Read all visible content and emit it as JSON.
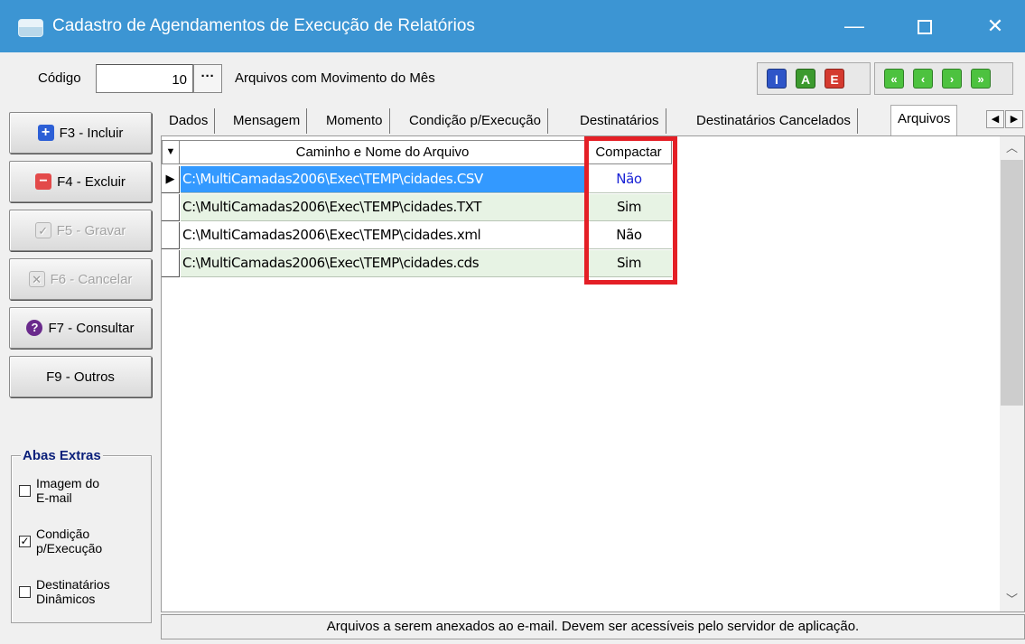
{
  "window": {
    "title": "Cadastro de Agendamentos de Execução de Relatórios",
    "minimize": "—",
    "close": "✕"
  },
  "toprow": {
    "codigo_label": "Código",
    "codigo_value": "10",
    "ellipsis": "···",
    "description": "Arquivos com Movimento do Mês",
    "mode_buttons": [
      "I",
      "A",
      "E"
    ],
    "nav_buttons": [
      "«",
      "‹",
      "›",
      "»"
    ]
  },
  "commands": [
    {
      "label": "F3 - Incluir",
      "icon": "plus-icon",
      "glyph": "+",
      "enabled": true
    },
    {
      "label": "F4 - Excluir",
      "icon": "minus-icon",
      "glyph": "−",
      "enabled": true
    },
    {
      "label": "F5 - Gravar",
      "icon": "check-icon",
      "glyph": "✓",
      "enabled": false
    },
    {
      "label": "F6 - Cancelar",
      "icon": "x-icon",
      "glyph": "✕",
      "enabled": false
    },
    {
      "label": "F7 - Consultar",
      "icon": "help-icon",
      "glyph": "?",
      "enabled": true
    },
    {
      "label": "F9 - Outros",
      "icon": "",
      "glyph": "",
      "enabled": true
    }
  ],
  "abas_extras": {
    "title": "Abas Extras",
    "items": [
      {
        "label_line1": "Imagem do",
        "label_line2": "E-mail",
        "checked": false
      },
      {
        "label_line1": "Condição",
        "label_line2": "p/Execução",
        "checked": true
      },
      {
        "label_line1": "Destinatários",
        "label_line2": "Dinâmicos",
        "checked": false
      }
    ]
  },
  "tabs": [
    "Dados",
    "Mensagem",
    "Momento",
    "Condição p/Execução",
    "Destinatários",
    "Destinatários Cancelados",
    "Arquivos"
  ],
  "active_tab": "Arquivos",
  "grid": {
    "columns": [
      "Caminho e Nome do Arquivo",
      "Compactar"
    ],
    "rows": [
      {
        "path": "C:\\MultiCamadas2006\\Exec\\TEMP\\cidades.CSV",
        "compactar": "Não"
      },
      {
        "path": "C:\\MultiCamadas2006\\Exec\\TEMP\\cidades.TXT",
        "compactar": "Sim"
      },
      {
        "path": "C:\\MultiCamadas2006\\Exec\\TEMP\\cidades.xml",
        "compactar": "Não"
      },
      {
        "path": "C:\\MultiCamadas2006\\Exec\\TEMP\\cidades.cds",
        "compactar": "Sim"
      }
    ]
  },
  "status_text": "Arquivos a serem anexados ao e-mail. Devem ser acessíveis pelo servidor de aplicação.",
  "colors": {
    "titlebar": "#3c95d3",
    "selection": "#3399ff",
    "highlight": "#e41f26",
    "alt_row": "#e7f3e4"
  }
}
